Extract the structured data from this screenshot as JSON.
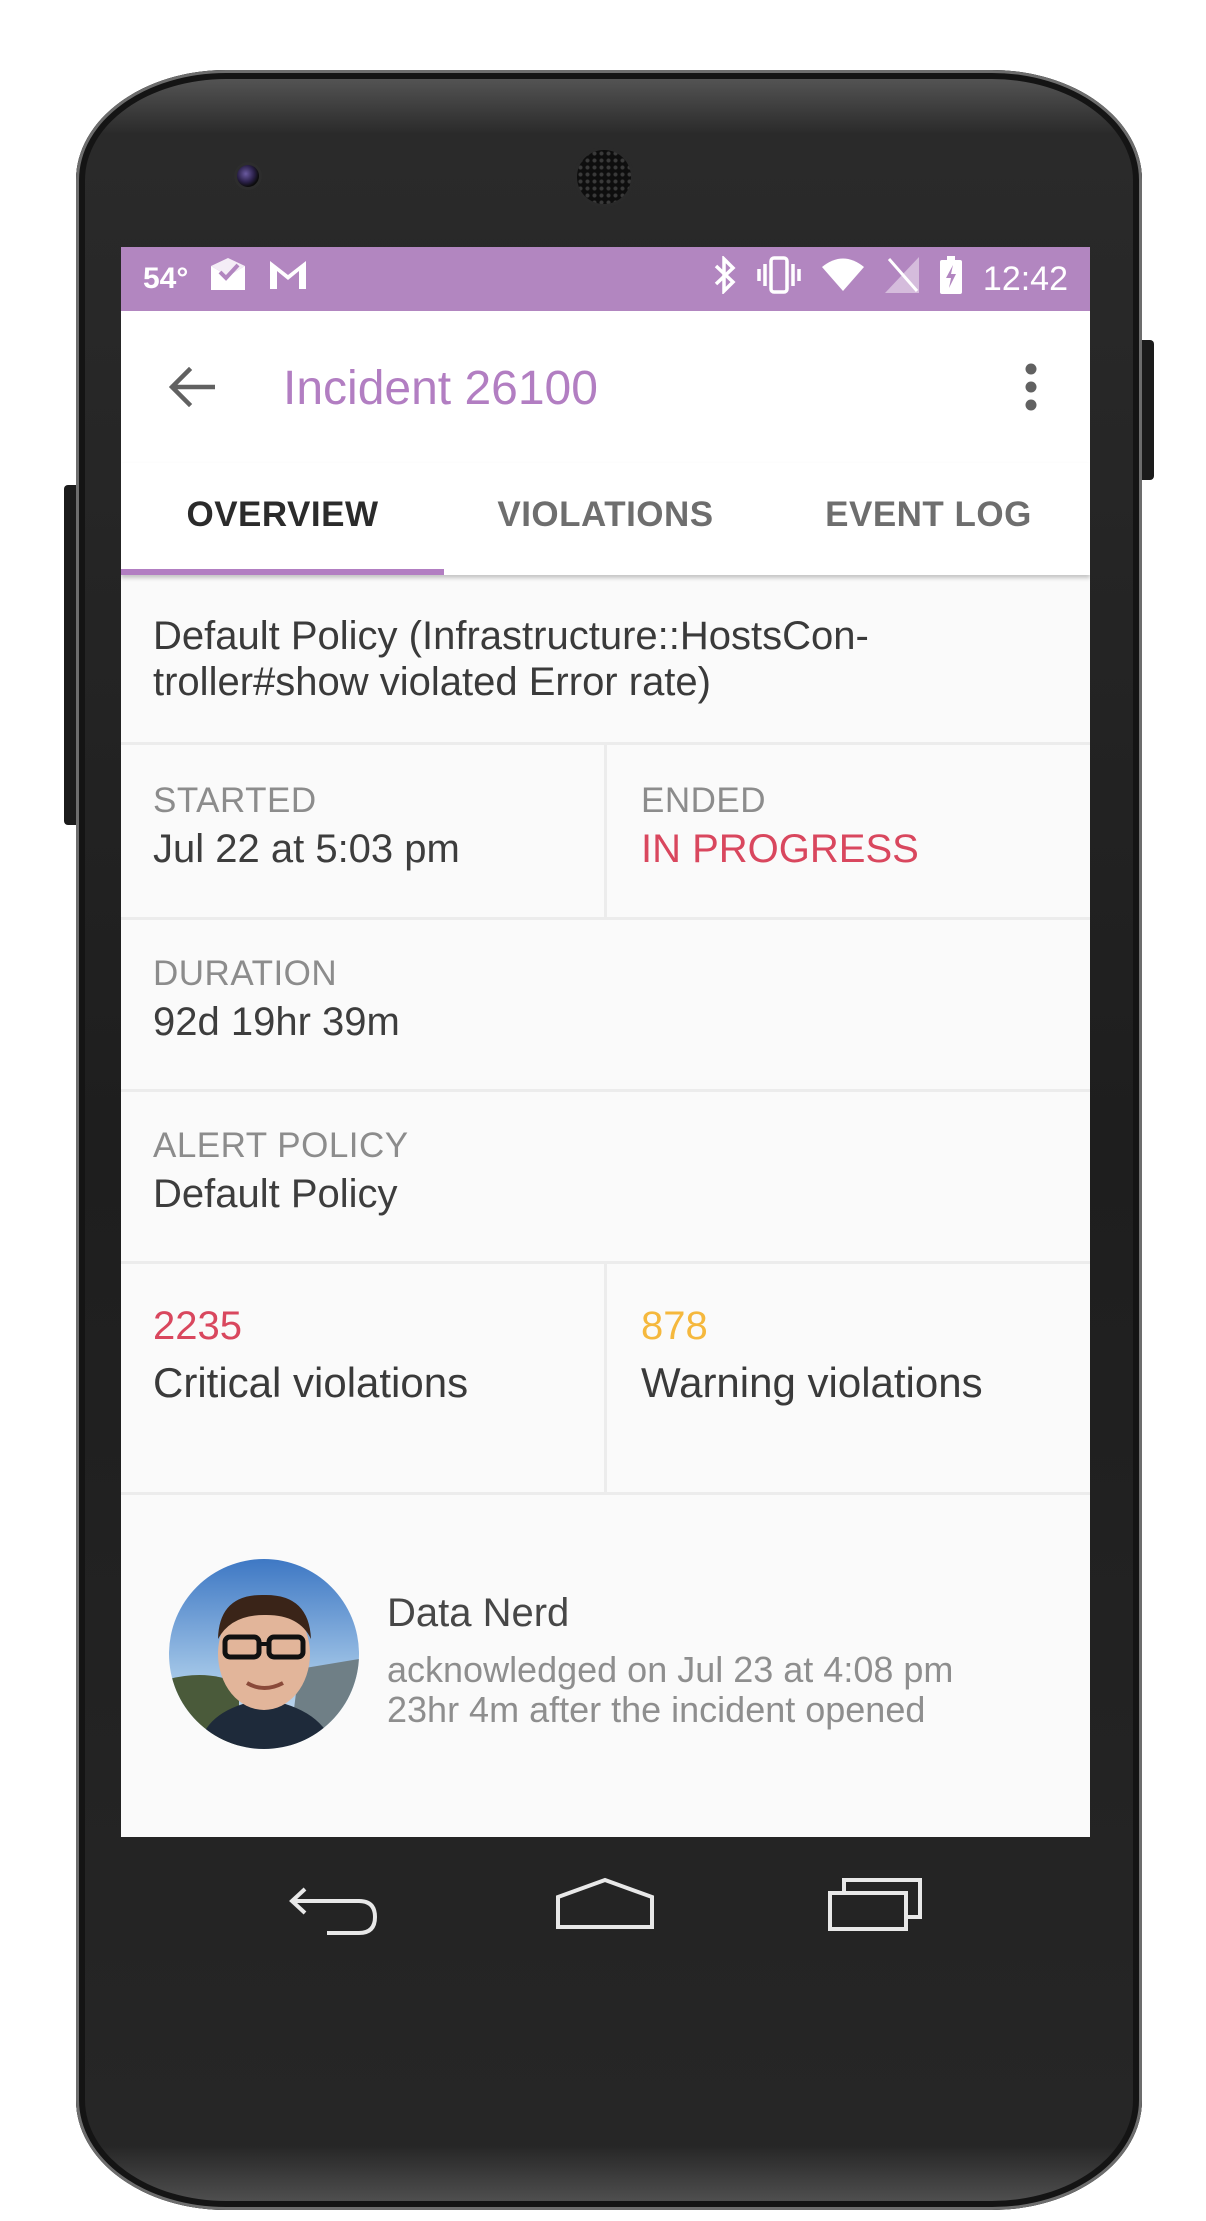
{
  "status_bar": {
    "temperature": "54°",
    "time": "12:42",
    "background_color": "#b286c0",
    "left_icons": [
      "weather-temp",
      "mail-check-icon",
      "gmail-icon"
    ],
    "right_icons": [
      "bluetooth-icon",
      "vibrate-icon",
      "wifi-icon",
      "no-sim-icon",
      "battery-charging-icon"
    ]
  },
  "app_bar": {
    "title": "Incident 26100",
    "accent_color": "#b27ec2"
  },
  "tabs": [
    {
      "label": "OVERVIEW",
      "active": true
    },
    {
      "label": "VIOLATIONS",
      "active": false
    },
    {
      "label": "EVENT LOG",
      "active": false
    }
  ],
  "overview": {
    "description_line1": "Default Policy (Infrastructure::HostsCon-",
    "description_line2": "troller#show violated Error rate)",
    "started_label": "STARTED",
    "started_value": "Jul 22 at 5:03 pm",
    "ended_label": "ENDED",
    "ended_value": "IN PROGRESS",
    "ended_color": "#d9475e",
    "duration_label": "DURATION",
    "duration_value": "92d 19hr 39m",
    "policy_label": "ALERT POLICY",
    "policy_value": "Default Policy",
    "critical_count": "2235",
    "critical_label": "Critical violations",
    "critical_color": "#d9475e",
    "warning_count": "878",
    "warning_label": "Warning violations",
    "warning_color": "#f5b83d"
  },
  "acknowledgement": {
    "name": "Data Nerd",
    "line1": "acknowledged on Jul 23 at 4:08 pm",
    "line2": "23hr 4m after the incident opened"
  },
  "nav_bar": {
    "buttons": [
      "back-icon",
      "home-icon",
      "recents-icon"
    ]
  }
}
